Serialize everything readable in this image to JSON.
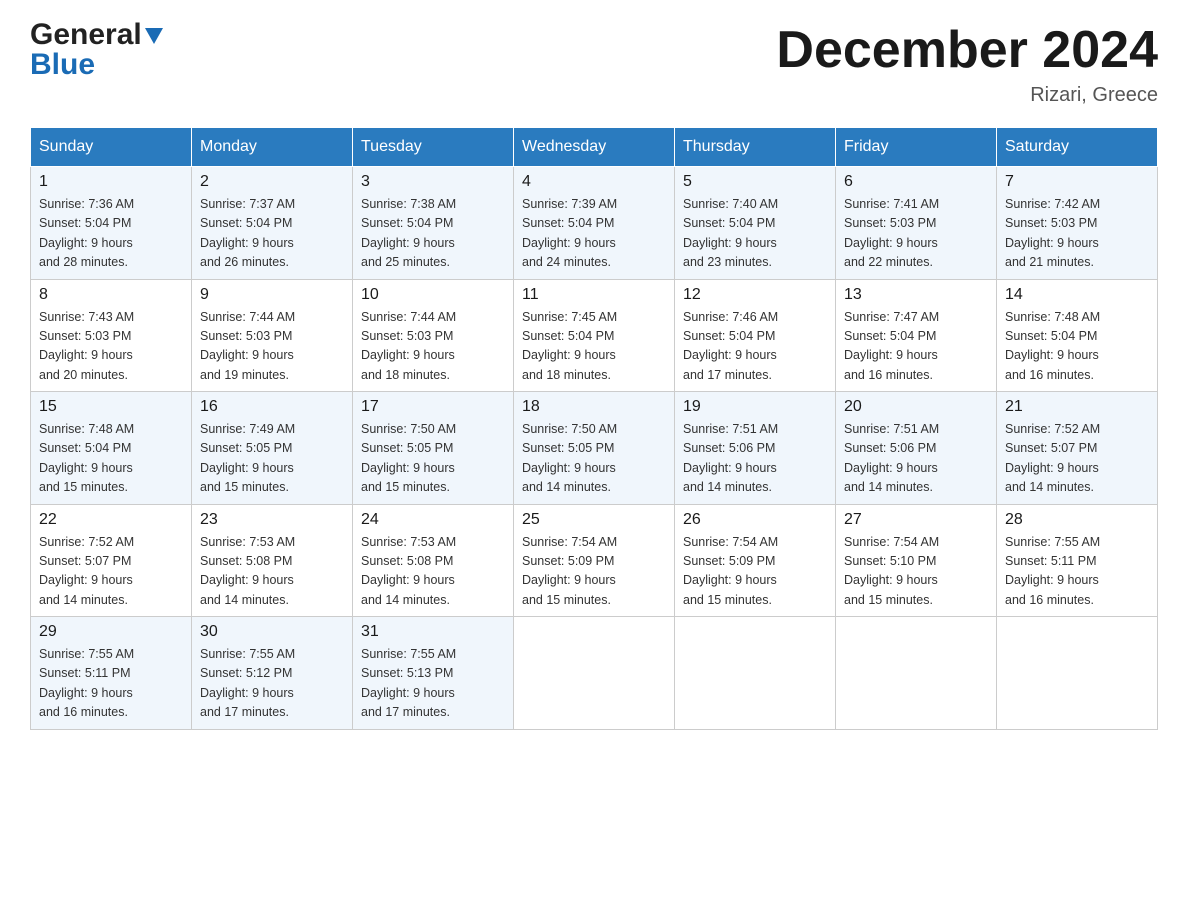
{
  "header": {
    "logo_top": "General",
    "logo_bottom": "Blue",
    "month_title": "December 2024",
    "location": "Rizari, Greece"
  },
  "days_of_week": [
    "Sunday",
    "Monday",
    "Tuesday",
    "Wednesday",
    "Thursday",
    "Friday",
    "Saturday"
  ],
  "weeks": [
    [
      {
        "day": "1",
        "sunrise": "7:36 AM",
        "sunset": "5:04 PM",
        "daylight": "9 hours and 28 minutes."
      },
      {
        "day": "2",
        "sunrise": "7:37 AM",
        "sunset": "5:04 PM",
        "daylight": "9 hours and 26 minutes."
      },
      {
        "day": "3",
        "sunrise": "7:38 AM",
        "sunset": "5:04 PM",
        "daylight": "9 hours and 25 minutes."
      },
      {
        "day": "4",
        "sunrise": "7:39 AM",
        "sunset": "5:04 PM",
        "daylight": "9 hours and 24 minutes."
      },
      {
        "day": "5",
        "sunrise": "7:40 AM",
        "sunset": "5:04 PM",
        "daylight": "9 hours and 23 minutes."
      },
      {
        "day": "6",
        "sunrise": "7:41 AM",
        "sunset": "5:03 PM",
        "daylight": "9 hours and 22 minutes."
      },
      {
        "day": "7",
        "sunrise": "7:42 AM",
        "sunset": "5:03 PM",
        "daylight": "9 hours and 21 minutes."
      }
    ],
    [
      {
        "day": "8",
        "sunrise": "7:43 AM",
        "sunset": "5:03 PM",
        "daylight": "9 hours and 20 minutes."
      },
      {
        "day": "9",
        "sunrise": "7:44 AM",
        "sunset": "5:03 PM",
        "daylight": "9 hours and 19 minutes."
      },
      {
        "day": "10",
        "sunrise": "7:44 AM",
        "sunset": "5:03 PM",
        "daylight": "9 hours and 18 minutes."
      },
      {
        "day": "11",
        "sunrise": "7:45 AM",
        "sunset": "5:04 PM",
        "daylight": "9 hours and 18 minutes."
      },
      {
        "day": "12",
        "sunrise": "7:46 AM",
        "sunset": "5:04 PM",
        "daylight": "9 hours and 17 minutes."
      },
      {
        "day": "13",
        "sunrise": "7:47 AM",
        "sunset": "5:04 PM",
        "daylight": "9 hours and 16 minutes."
      },
      {
        "day": "14",
        "sunrise": "7:48 AM",
        "sunset": "5:04 PM",
        "daylight": "9 hours and 16 minutes."
      }
    ],
    [
      {
        "day": "15",
        "sunrise": "7:48 AM",
        "sunset": "5:04 PM",
        "daylight": "9 hours and 15 minutes."
      },
      {
        "day": "16",
        "sunrise": "7:49 AM",
        "sunset": "5:05 PM",
        "daylight": "9 hours and 15 minutes."
      },
      {
        "day": "17",
        "sunrise": "7:50 AM",
        "sunset": "5:05 PM",
        "daylight": "9 hours and 15 minutes."
      },
      {
        "day": "18",
        "sunrise": "7:50 AM",
        "sunset": "5:05 PM",
        "daylight": "9 hours and 14 minutes."
      },
      {
        "day": "19",
        "sunrise": "7:51 AM",
        "sunset": "5:06 PM",
        "daylight": "9 hours and 14 minutes."
      },
      {
        "day": "20",
        "sunrise": "7:51 AM",
        "sunset": "5:06 PM",
        "daylight": "9 hours and 14 minutes."
      },
      {
        "day": "21",
        "sunrise": "7:52 AM",
        "sunset": "5:07 PM",
        "daylight": "9 hours and 14 minutes."
      }
    ],
    [
      {
        "day": "22",
        "sunrise": "7:52 AM",
        "sunset": "5:07 PM",
        "daylight": "9 hours and 14 minutes."
      },
      {
        "day": "23",
        "sunrise": "7:53 AM",
        "sunset": "5:08 PM",
        "daylight": "9 hours and 14 minutes."
      },
      {
        "day": "24",
        "sunrise": "7:53 AM",
        "sunset": "5:08 PM",
        "daylight": "9 hours and 14 minutes."
      },
      {
        "day": "25",
        "sunrise": "7:54 AM",
        "sunset": "5:09 PM",
        "daylight": "9 hours and 15 minutes."
      },
      {
        "day": "26",
        "sunrise": "7:54 AM",
        "sunset": "5:09 PM",
        "daylight": "9 hours and 15 minutes."
      },
      {
        "day": "27",
        "sunrise": "7:54 AM",
        "sunset": "5:10 PM",
        "daylight": "9 hours and 15 minutes."
      },
      {
        "day": "28",
        "sunrise": "7:55 AM",
        "sunset": "5:11 PM",
        "daylight": "9 hours and 16 minutes."
      }
    ],
    [
      {
        "day": "29",
        "sunrise": "7:55 AM",
        "sunset": "5:11 PM",
        "daylight": "9 hours and 16 minutes."
      },
      {
        "day": "30",
        "sunrise": "7:55 AM",
        "sunset": "5:12 PM",
        "daylight": "9 hours and 17 minutes."
      },
      {
        "day": "31",
        "sunrise": "7:55 AM",
        "sunset": "5:13 PM",
        "daylight": "9 hours and 17 minutes."
      },
      null,
      null,
      null,
      null
    ]
  ],
  "labels": {
    "sunrise": "Sunrise:",
    "sunset": "Sunset:",
    "daylight": "Daylight:"
  }
}
